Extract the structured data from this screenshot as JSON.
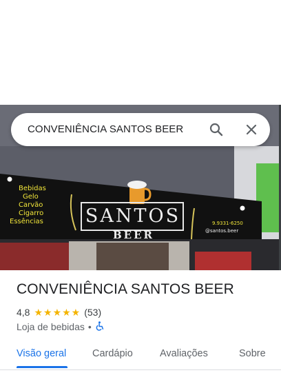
{
  "search": {
    "query": "CONVENIÊNCIA SANTOS BEER",
    "search_icon": "search-icon",
    "close_icon": "close-icon"
  },
  "photo": {
    "sign_left_lines": [
      "Bebidas",
      "Gelo",
      "Carvão",
      "Cigarro",
      "Essências"
    ],
    "sign_main": "SANTOS",
    "sign_sub": "BEER",
    "sign_phone": "9.9331-6250",
    "sign_handle": "@santos.beer"
  },
  "place": {
    "name": "CONVENIÊNCIA SANTOS BEER",
    "rating": "4,8",
    "stars": "★★★★★",
    "reviews": "(53)",
    "category": "Loja de bebidas",
    "separator": "•",
    "accessibility_icon": "wheelchair-icon"
  },
  "tabs": [
    {
      "label": "Visão geral",
      "active": true
    },
    {
      "label": "Cardápio",
      "active": false
    },
    {
      "label": "Avaliações",
      "active": false
    },
    {
      "label": "Sobre",
      "active": false
    }
  ],
  "colors": {
    "accent": "#1a73e8",
    "star": "#f4b400",
    "sign_text": "#f2e63a"
  }
}
